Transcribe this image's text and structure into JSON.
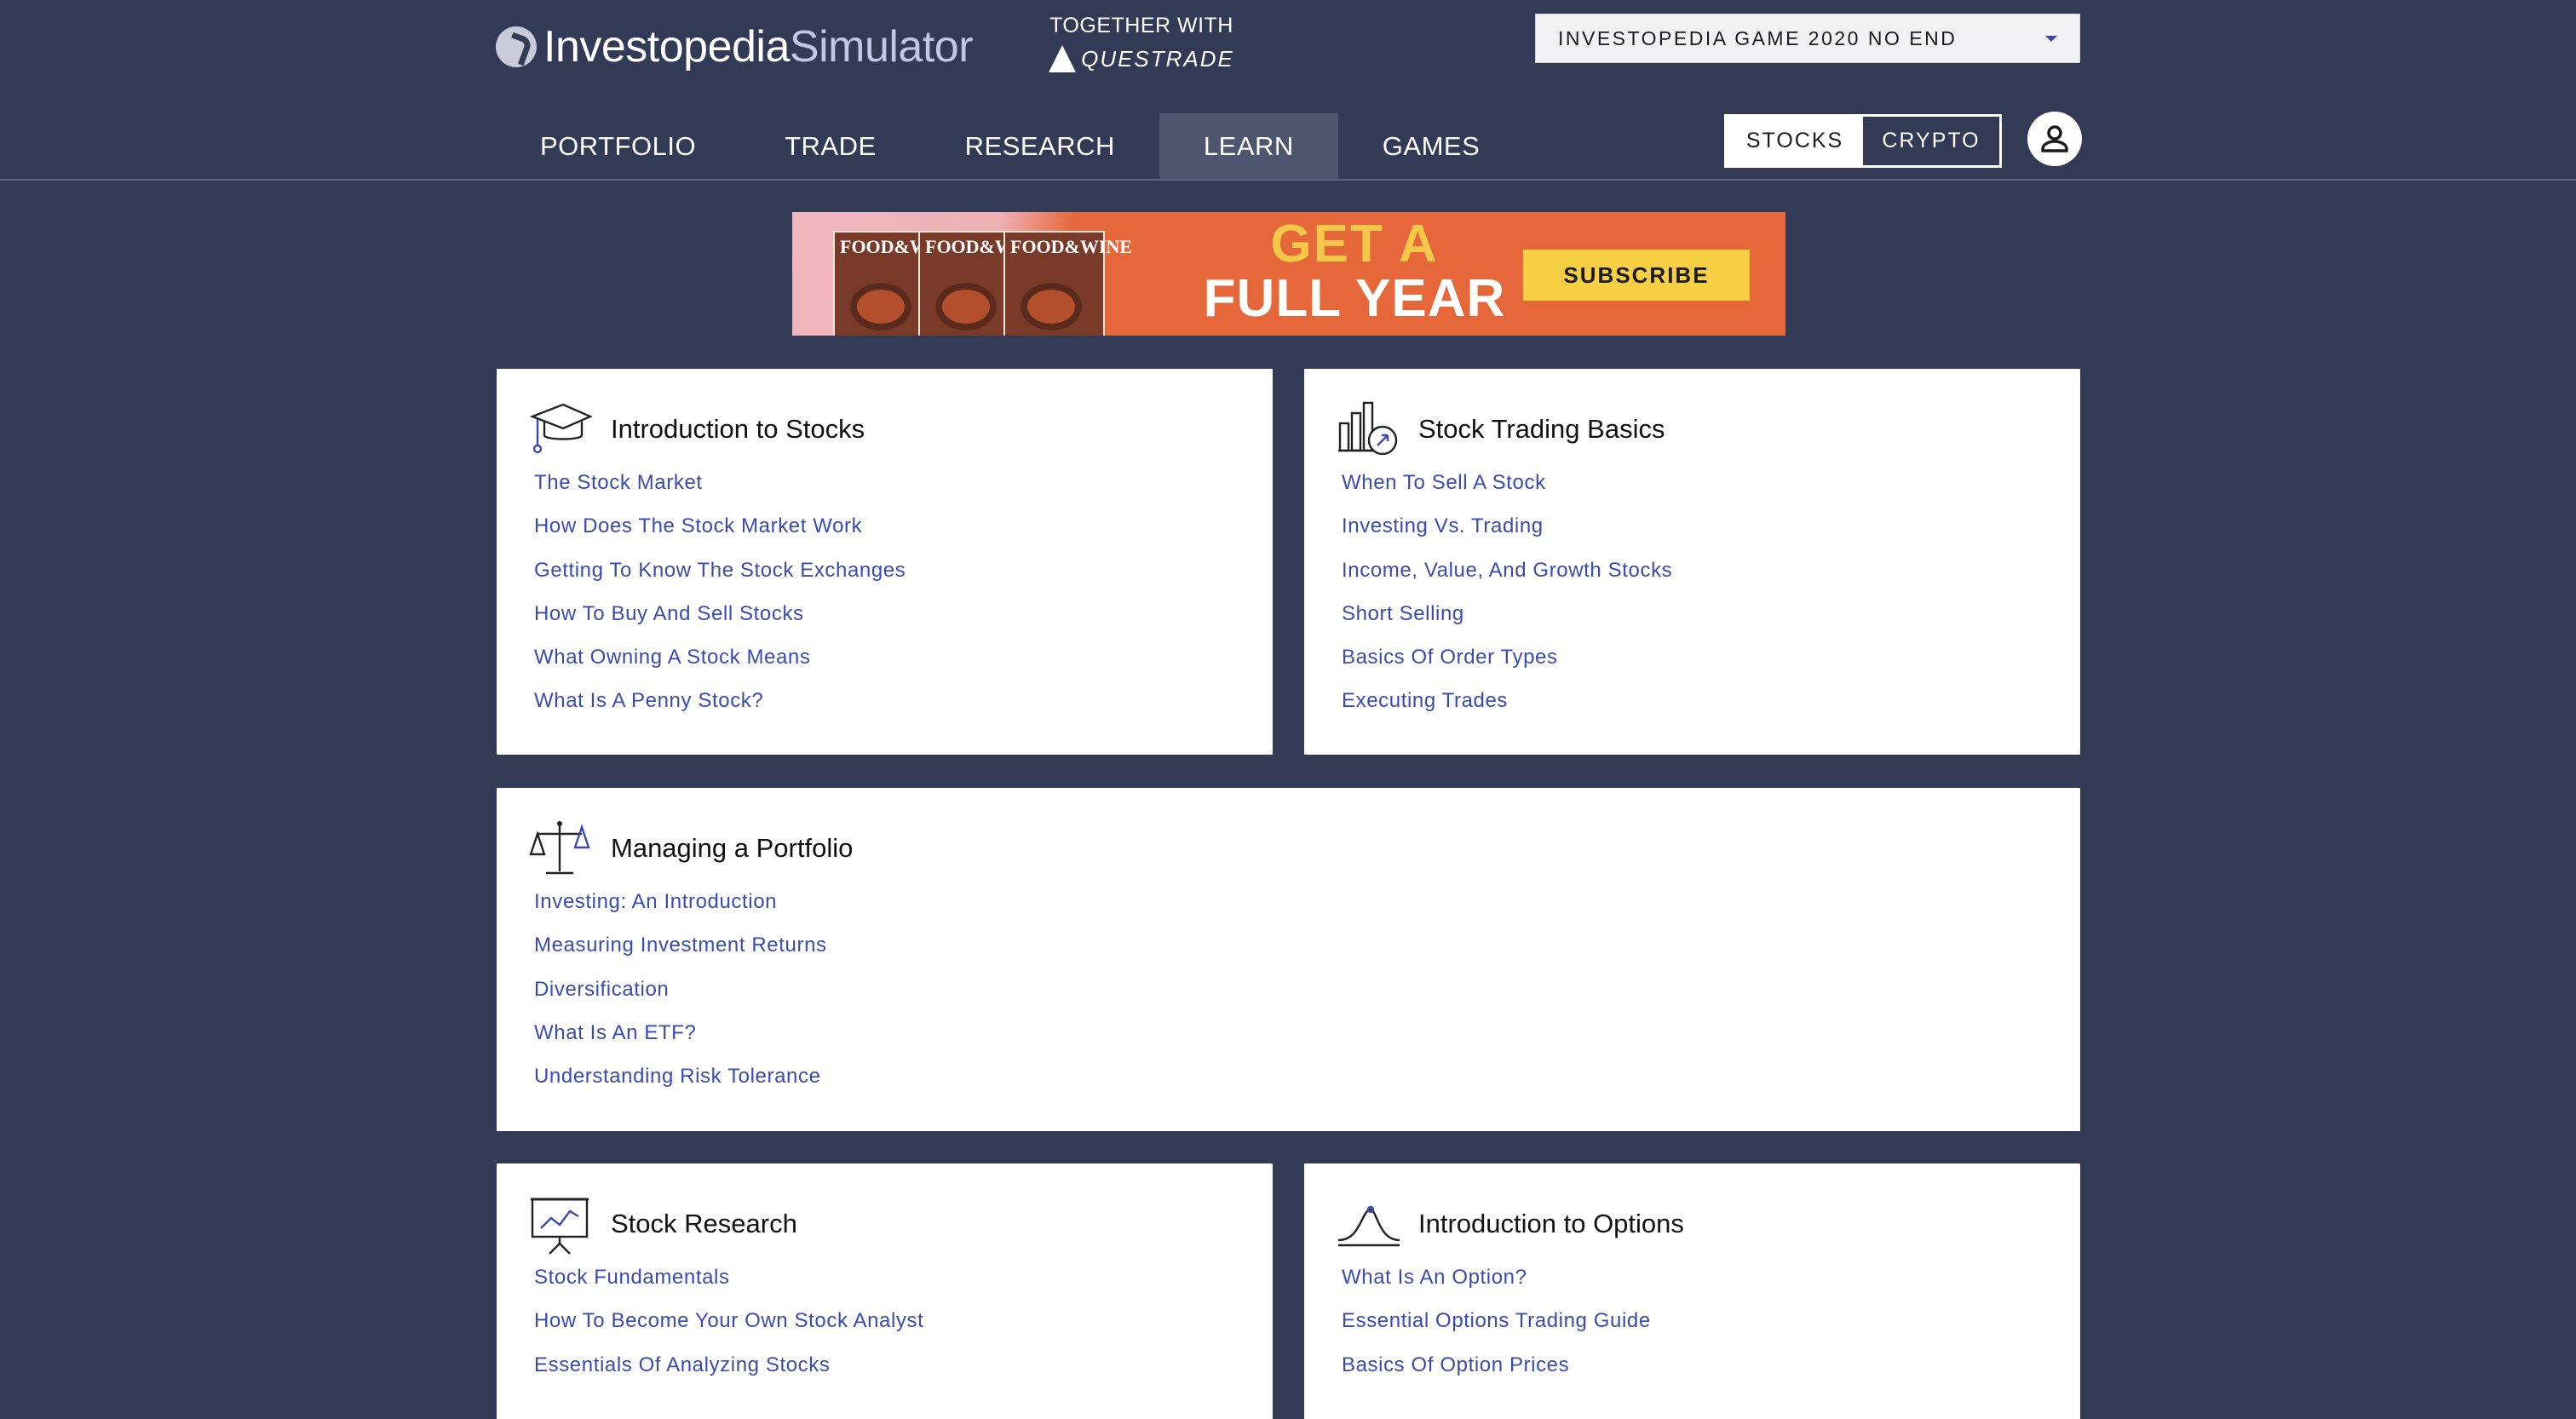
{
  "header": {
    "logo_part1": "Investopedia",
    "logo_part2": "Simulator",
    "together_with": "TOGETHER WITH",
    "partner_name": "QUESTRADE",
    "game_selector": "INVESTOPEDIA GAME 2020 NO END"
  },
  "nav": {
    "items": [
      {
        "label": "PORTFOLIO"
      },
      {
        "label": "TRADE"
      },
      {
        "label": "RESEARCH"
      },
      {
        "label": "LEARN"
      },
      {
        "label": "GAMES"
      }
    ],
    "active": "LEARN"
  },
  "asset_toggle": {
    "stocks": "STOCKS",
    "crypto": "CRYPTO",
    "selected": "STOCKS"
  },
  "ad": {
    "magazine_title": "FOOD&WINE",
    "line1": "GET A",
    "line2": "FULL YEAR",
    "cta": "SUBSCRIBE"
  },
  "cards": {
    "intro_stocks": {
      "title": "Introduction to Stocks",
      "icon": "graduation-cap-icon",
      "links": [
        "The Stock Market",
        "How Does The Stock Market Work",
        "Getting To Know The Stock Exchanges",
        "How To Buy And Sell Stocks",
        "What Owning A Stock Means",
        "What Is A Penny Stock?"
      ]
    },
    "trading_basics": {
      "title": "Stock Trading Basics",
      "icon": "bar-chart-clock-icon",
      "links": [
        "When To Sell A Stock",
        "Investing Vs. Trading",
        "Income, Value, And Growth Stocks",
        "Short Selling",
        "Basics Of Order Types",
        "Executing Trades"
      ]
    },
    "managing_portfolio": {
      "title": "Managing a Portfolio",
      "icon": "balance-scale-icon",
      "links": [
        "Investing: An Introduction",
        "Measuring Investment Returns",
        "Diversification",
        "What Is An ETF?",
        "Understanding Risk Tolerance"
      ]
    },
    "stock_research": {
      "title": "Stock Research",
      "icon": "presentation-board-icon",
      "links": [
        "Stock Fundamentals",
        "How To Become Your Own Stock Analyst",
        "Essentials Of Analyzing Stocks"
      ]
    },
    "intro_options": {
      "title": "Introduction to Options",
      "icon": "bell-curve-icon",
      "links": [
        "What Is An Option?",
        "Essential Options Trading Guide",
        "Basics Of Option Prices"
      ]
    }
  },
  "colors": {
    "background": "#333a56",
    "link": "#3a4bb0",
    "active_tab": "#4d556f"
  }
}
